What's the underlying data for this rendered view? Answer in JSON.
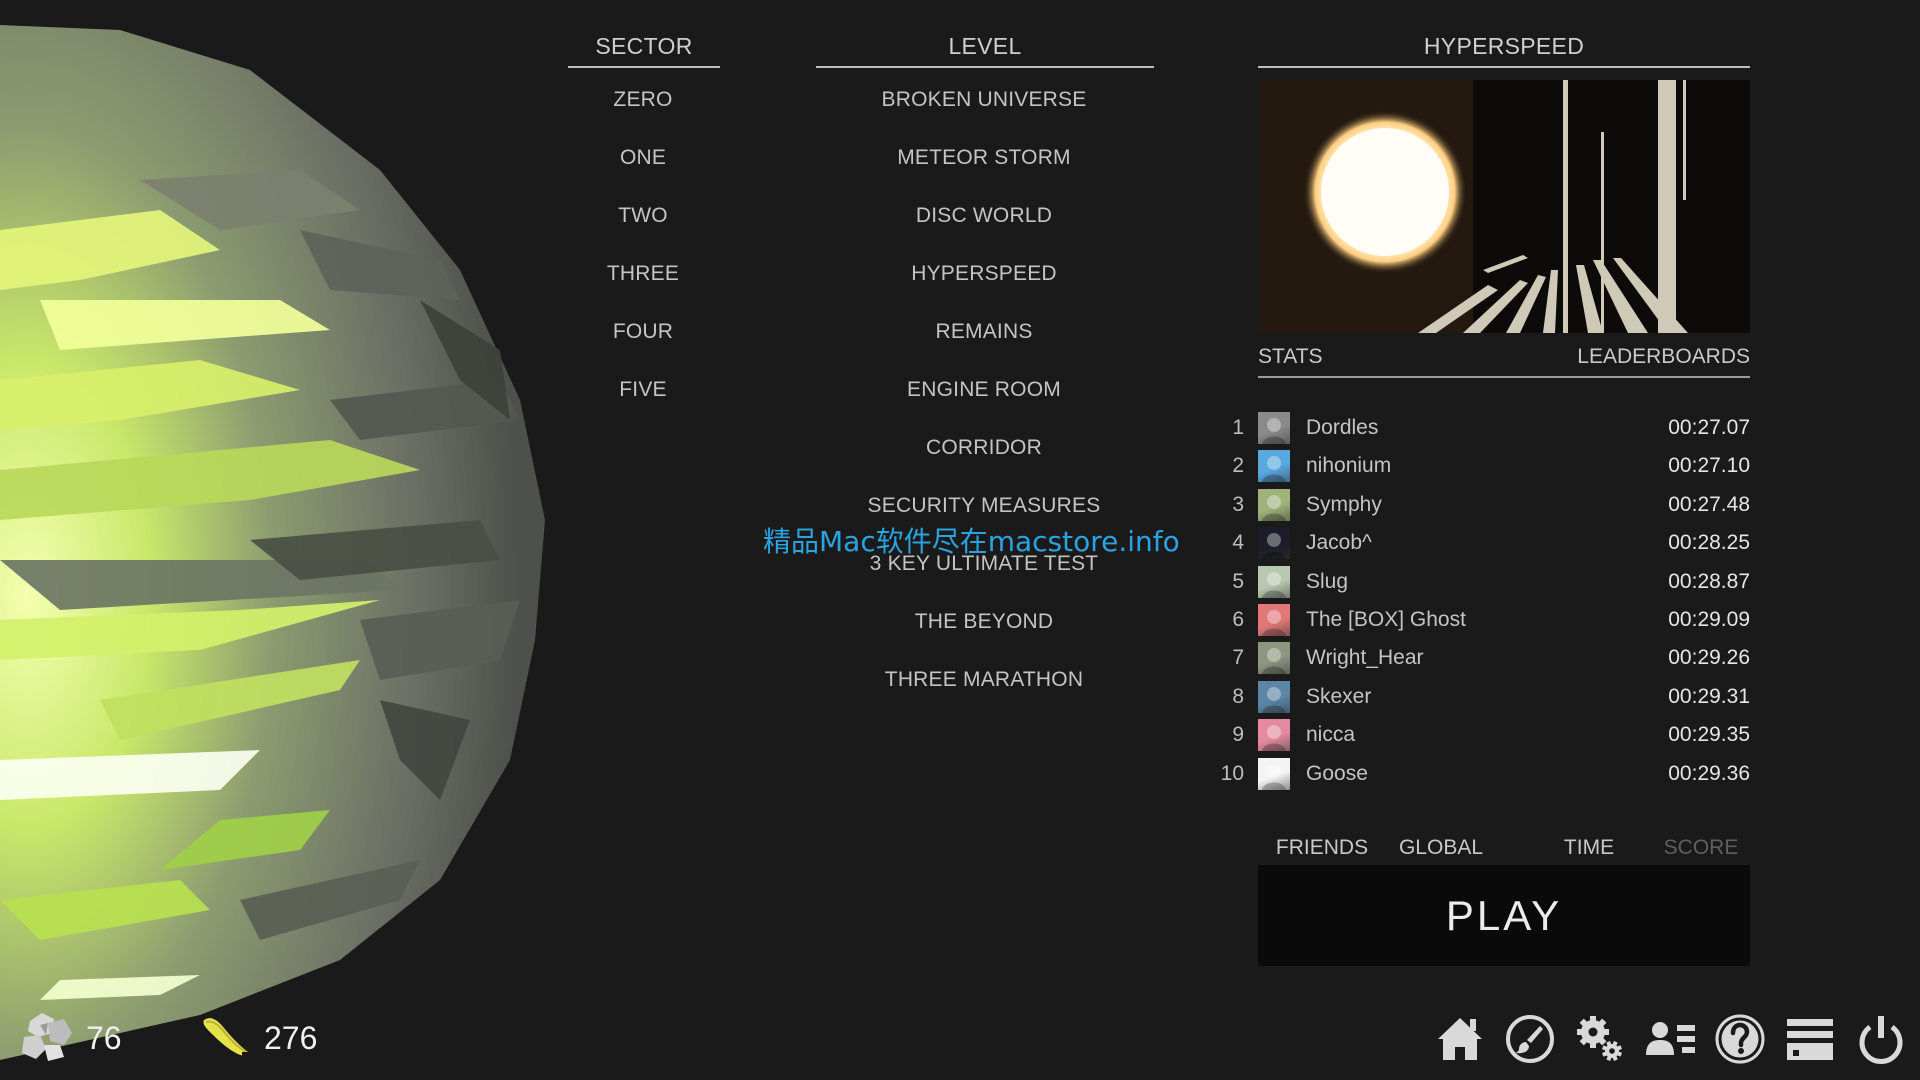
{
  "sector": {
    "header": "SECTOR",
    "items": [
      "ZERO",
      "ONE",
      "TWO",
      "THREE",
      "FOUR",
      "FIVE"
    ]
  },
  "level": {
    "header": "LEVEL",
    "items": [
      "BROKEN UNIVERSE",
      "METEOR STORM",
      "DISC WORLD",
      "HYPERSPEED",
      "REMAINS",
      "ENGINE ROOM",
      "CORRIDOR",
      "SECURITY MEASURES",
      "3 KEY ULTIMATE TEST",
      "THE BEYOND",
      "THREE MARATHON"
    ]
  },
  "detail": {
    "header": "HYPERSPEED",
    "stats_label": "STATS",
    "leaderboards_label": "LEADERBOARDS"
  },
  "leaderboard": [
    {
      "rank": "1",
      "name": "Dordles",
      "time": "00:27.07",
      "avatar_color": "#8a8a8a"
    },
    {
      "rank": "2",
      "name": "nihonium",
      "time": "00:27.10",
      "avatar_color": "#5aa8e0"
    },
    {
      "rank": "3",
      "name": "Symphy",
      "time": "00:27.48",
      "avatar_color": "#9fb37a"
    },
    {
      "rank": "4",
      "name": "Jacob^",
      "time": "00:28.25",
      "avatar_color": "#1c1c2a"
    },
    {
      "rank": "5",
      "name": "Slug",
      "time": "00:28.87",
      "avatar_color": "#b9c8b0"
    },
    {
      "rank": "6",
      "name": "The [BOX] Ghost",
      "time": "00:29.09",
      "avatar_color": "#e07878"
    },
    {
      "rank": "7",
      "name": "Wright_Hear",
      "time": "00:29.26",
      "avatar_color": "#8e9682"
    },
    {
      "rank": "8",
      "name": "Skexer",
      "time": "00:29.31",
      "avatar_color": "#5b86a8"
    },
    {
      "rank": "9",
      "name": "nicca",
      "time": "00:29.35",
      "avatar_color": "#e58aa0"
    },
    {
      "rank": "10",
      "name": "Goose",
      "time": "00:29.36",
      "avatar_color": "#f4f4f4"
    }
  ],
  "tabs": {
    "friends": "FRIENDS",
    "global": "GLOBAL",
    "time": "TIME",
    "score": "SCORE"
  },
  "play_label": "PLAY",
  "counters": {
    "cubes": "76",
    "bananas": "276"
  },
  "toolbar": {
    "icons": [
      "home-icon",
      "customize-brush-icon",
      "settings-gears-icon",
      "profile-list-icon",
      "help-icon",
      "log-menu-icon",
      "power-icon"
    ]
  },
  "watermark": "精品Mac软件尽在macstore.info",
  "colors": {
    "background": "#1a1a1a",
    "text": "#c9c9c9",
    "play_bg": "#0a0a0a",
    "accent_green": "#c8f060",
    "watermark": "#2aa3e0"
  }
}
